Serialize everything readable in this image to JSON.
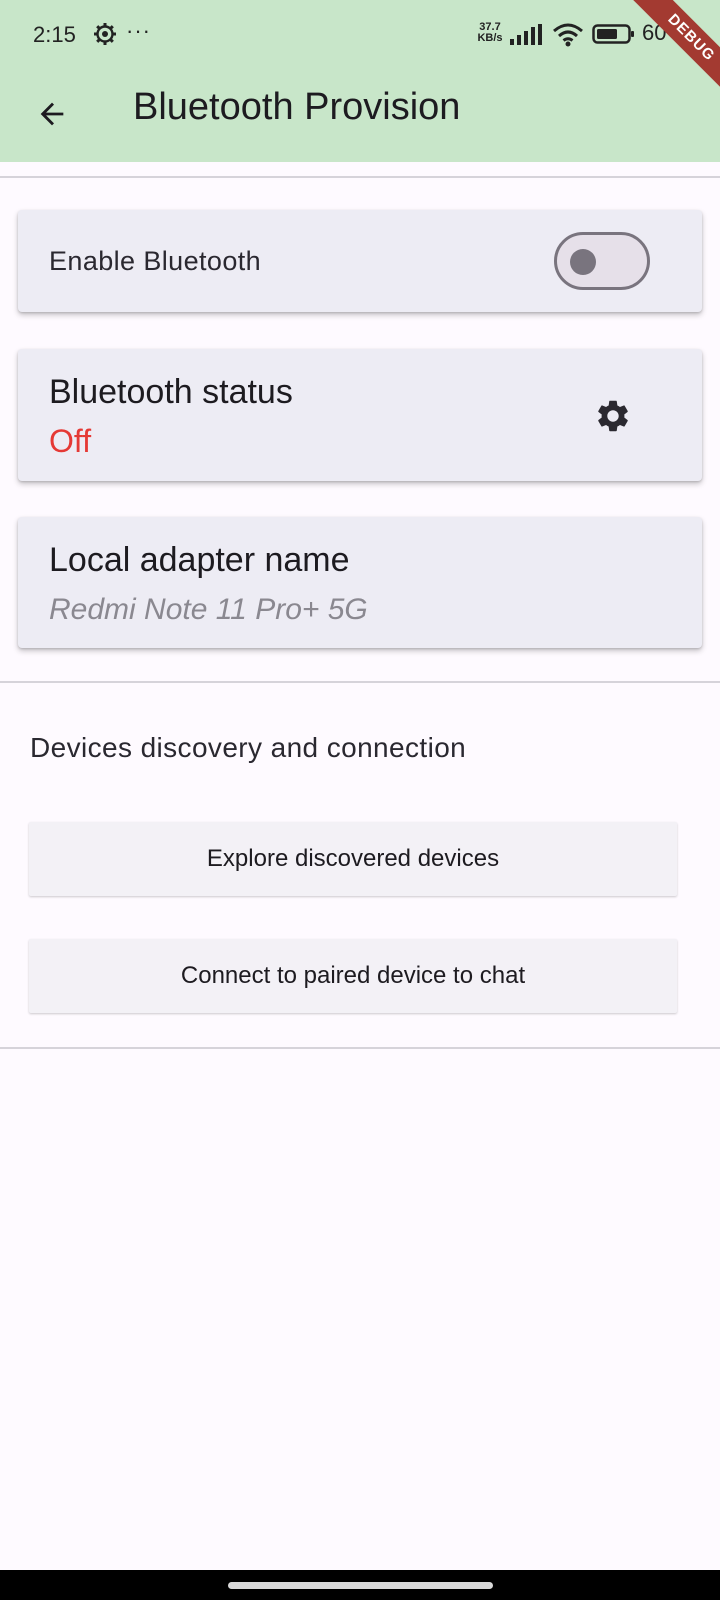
{
  "status_bar": {
    "time": "2:15",
    "more": "···",
    "net_speed_value": "37.7",
    "net_speed_unit": "KB/s",
    "battery": "60"
  },
  "debug_banner": "DEBUG",
  "app_bar": {
    "title": "Bluetooth Provision",
    "back_icon": "arrow-back-icon"
  },
  "enable_card": {
    "label": "Enable Bluetooth",
    "switch_on": false
  },
  "status_card": {
    "title": "Bluetooth status",
    "value": "Off",
    "value_color": "#e53935",
    "action_icon": "settings-icon"
  },
  "adapter_card": {
    "title": "Local adapter name",
    "value": "Redmi Note 11 Pro+ 5G"
  },
  "discovery": {
    "section_title": "Devices discovery and connection",
    "explore_button": "Explore discovered devices",
    "connect_button": "Connect to paired device to chat"
  },
  "colors": {
    "header_bg": "#c8e6c9",
    "page_bg": "#fefaff",
    "card_bg": "#edecf4",
    "status_off": "#e53935",
    "debug_ribbon": "#a33a31"
  }
}
